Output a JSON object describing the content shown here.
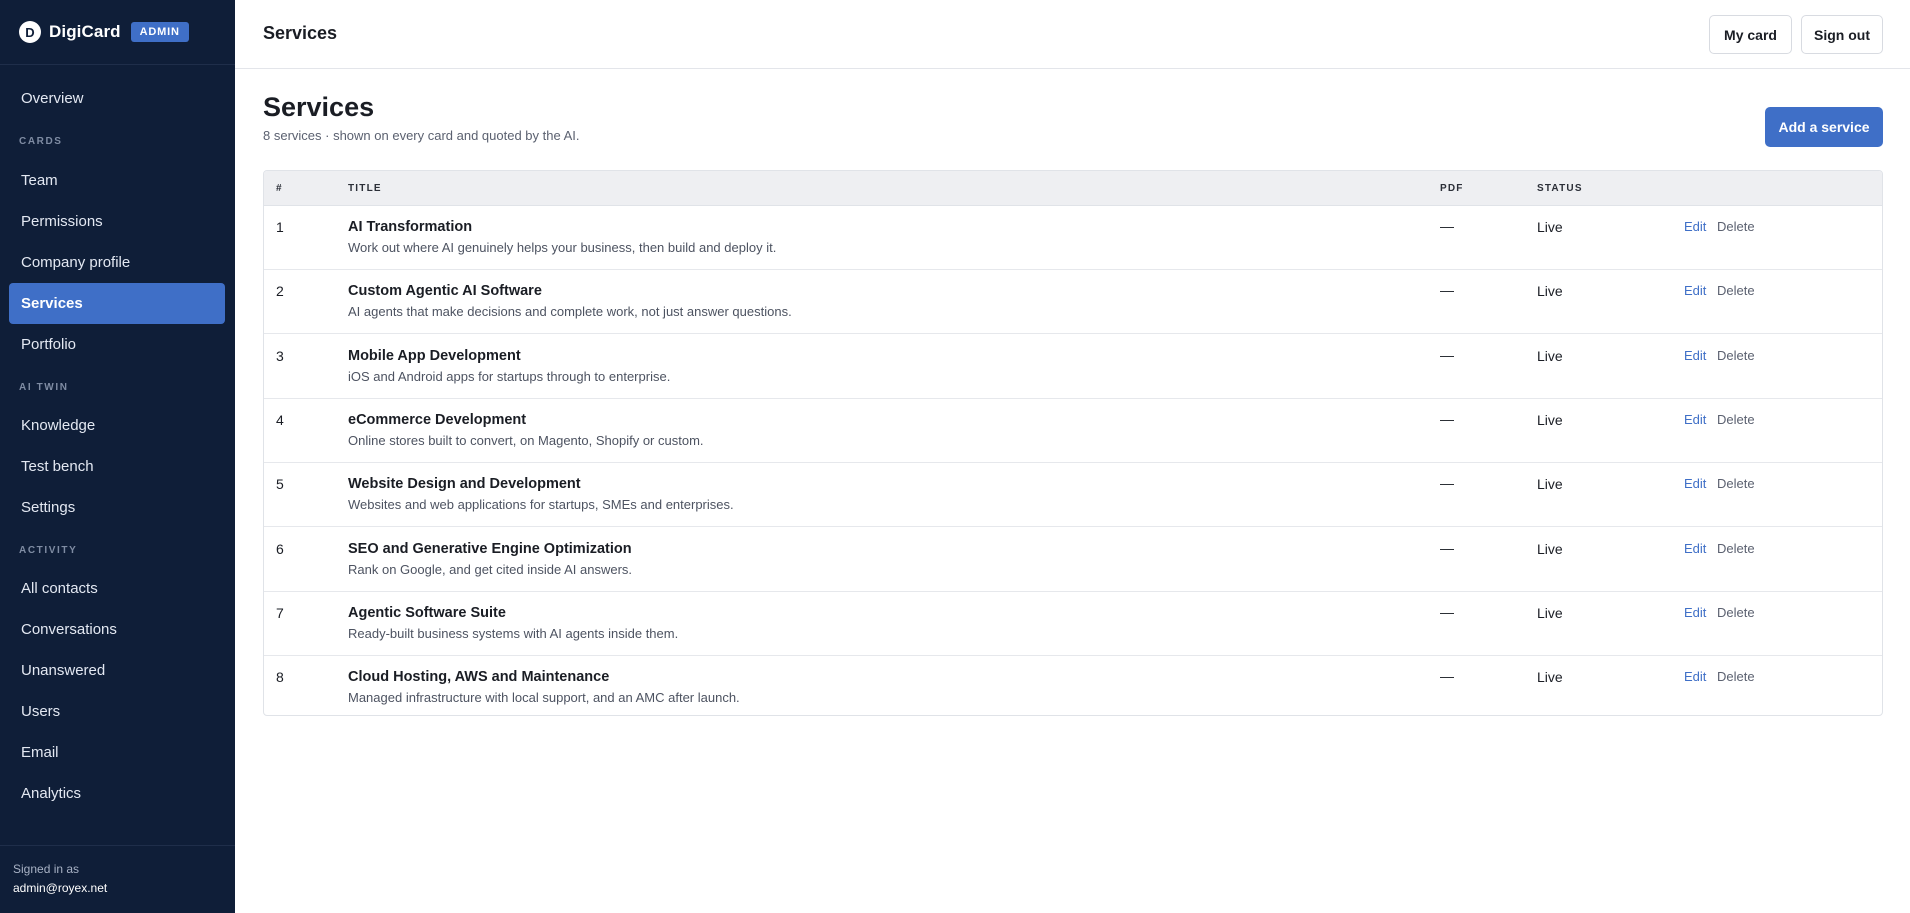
{
  "brand": {
    "logo_letter": "D",
    "name": "DigiCard",
    "badge": "ADMIN"
  },
  "sidebar": {
    "overview": "Overview",
    "sections": [
      {
        "label": "CARDS",
        "items": [
          "Team",
          "Permissions",
          "Company profile",
          "Services",
          "Portfolio"
        ]
      },
      {
        "label": "AI TWIN",
        "items": [
          "Knowledge",
          "Test bench",
          "Settings"
        ]
      },
      {
        "label": "ACTIVITY",
        "items": [
          "All contacts",
          "Conversations",
          "Unanswered",
          "Users",
          "Email",
          "Analytics"
        ]
      }
    ],
    "active_item": "Services"
  },
  "signed_in": {
    "label": "Signed in as",
    "email": "admin@royex.net"
  },
  "topbar": {
    "title": "Services",
    "my_card": "My card",
    "sign_out": "Sign out"
  },
  "page": {
    "title": "Services",
    "subtitle": "8 services · shown on every card and quoted by the AI.",
    "add_button": "Add a service"
  },
  "table": {
    "headers": {
      "num": "#",
      "title": "TITLE",
      "pdf": "PDF",
      "status": "STATUS"
    },
    "actions": {
      "edit": "Edit",
      "delete": "Delete"
    },
    "rows": [
      {
        "num": "1",
        "title": "AI Transformation",
        "desc": "Work out where AI genuinely helps your business, then build and deploy it.",
        "pdf": "—",
        "status": "Live"
      },
      {
        "num": "2",
        "title": "Custom Agentic AI Software",
        "desc": "AI agents that make decisions and complete work, not just answer questions.",
        "pdf": "—",
        "status": "Live"
      },
      {
        "num": "3",
        "title": "Mobile App Development",
        "desc": "iOS and Android apps for startups through to enterprise.",
        "pdf": "—",
        "status": "Live"
      },
      {
        "num": "4",
        "title": "eCommerce Development",
        "desc": "Online stores built to convert, on Magento, Shopify or custom.",
        "pdf": "—",
        "status": "Live"
      },
      {
        "num": "5",
        "title": "Website Design and Development",
        "desc": "Websites and web applications for startups, SMEs and enterprises.",
        "pdf": "—",
        "status": "Live"
      },
      {
        "num": "6",
        "title": "SEO and Generative Engine Optimization",
        "desc": "Rank on Google, and get cited inside AI answers.",
        "pdf": "—",
        "status": "Live"
      },
      {
        "num": "7",
        "title": "Agentic Software Suite",
        "desc": "Ready-built business systems with AI agents inside them.",
        "pdf": "—",
        "status": "Live"
      },
      {
        "num": "8",
        "title": "Cloud Hosting, AWS and Maintenance",
        "desc": "Managed infrastructure with local support, and an AMC after launch.",
        "pdf": "—",
        "status": "Live"
      }
    ]
  },
  "colors": {
    "sidebar_bg": "#0f1e38",
    "accent": "#3f6fc7"
  }
}
